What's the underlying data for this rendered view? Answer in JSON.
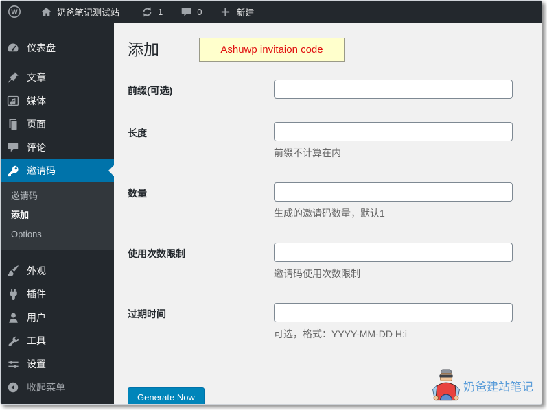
{
  "topbar": {
    "site_name": "奶爸笔记测试站",
    "update_count": "1",
    "comment_count": "0",
    "new_label": "新建"
  },
  "sidebar": {
    "items": [
      {
        "label": "仪表盘",
        "icon": "dashboard-icon"
      },
      {
        "label": "文章",
        "icon": "pin-icon"
      },
      {
        "label": "媒体",
        "icon": "media-icon"
      },
      {
        "label": "页面",
        "icon": "pages-icon"
      },
      {
        "label": "评论",
        "icon": "comments-icon"
      },
      {
        "label": "邀请码",
        "icon": "key-icon",
        "active": true
      },
      {
        "label": "外观",
        "icon": "brush-icon"
      },
      {
        "label": "插件",
        "icon": "plugin-icon"
      },
      {
        "label": "用户",
        "icon": "user-icon"
      },
      {
        "label": "工具",
        "icon": "wrench-icon"
      },
      {
        "label": "设置",
        "icon": "sliders-icon"
      }
    ],
    "submenu": [
      "邀请码",
      "添加",
      "Options"
    ],
    "collapse_label": "收起菜单"
  },
  "main": {
    "title": "添加",
    "tooltip": "Ashuwp invitaion code",
    "fields": [
      {
        "label": "前缀(可选)",
        "help": ""
      },
      {
        "label": "长度",
        "help": "前缀不计算在内"
      },
      {
        "label": "数量",
        "help": "生成的邀请码数量，默认1"
      },
      {
        "label": "使用次数限制",
        "help": "邀请码使用次数限制"
      },
      {
        "label": "过期时间",
        "help": "可选，格式：YYYY-MM-DD H:i"
      }
    ],
    "submit_label": "Generate Now",
    "watermark": "奶爸建站笔记"
  },
  "colors": {
    "topbar_bg": "#23282d",
    "submenu_bg": "#32373c",
    "active_blue": "#0073aa",
    "button_blue": "#0085ba",
    "content_bg": "#f1f1f1",
    "tooltip_bg": "#ffffcc",
    "tooltip_text": "#e01010",
    "watermark_text": "#5b9dd9"
  }
}
